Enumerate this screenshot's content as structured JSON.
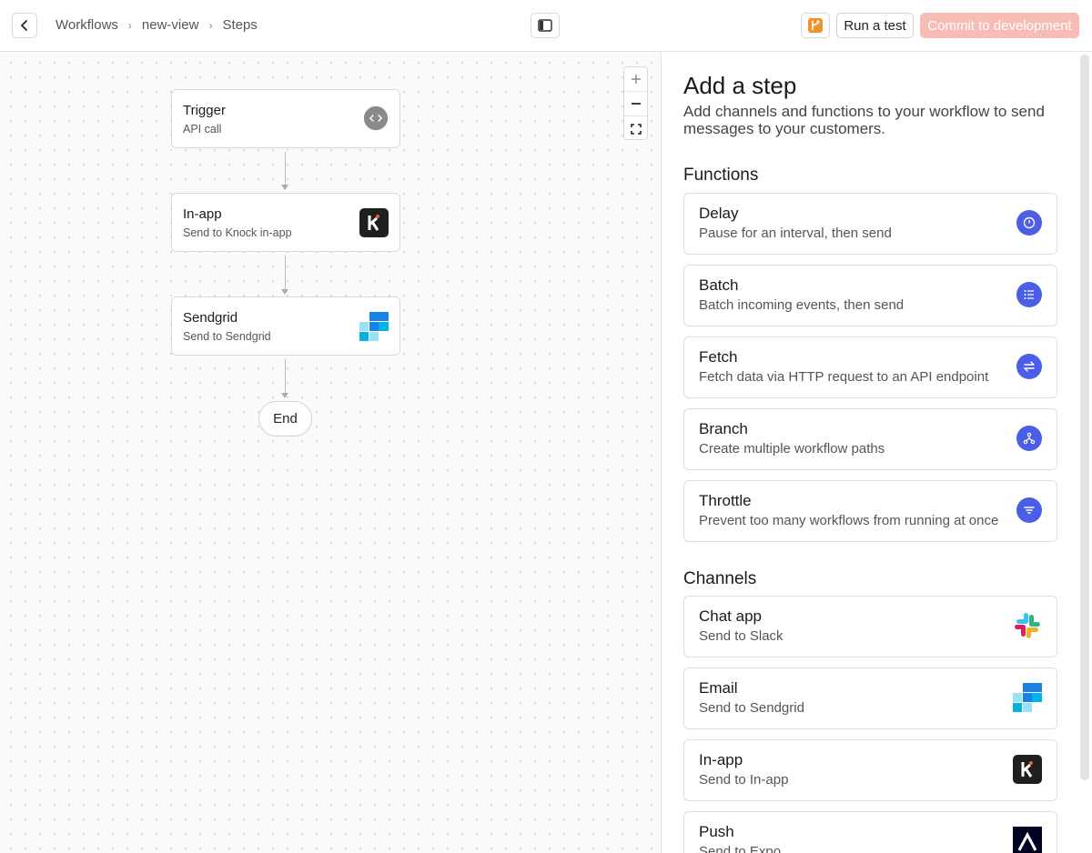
{
  "topbar": {
    "breadcrumbs": [
      "Workflows",
      "new-view",
      "Steps"
    ],
    "run_test_label": "Run a test",
    "commit_label": "Commit to development"
  },
  "canvas": {
    "nodes": [
      {
        "title": "Trigger",
        "subtitle": "API call",
        "icon": "code-icon"
      },
      {
        "title": "In-app",
        "subtitle": "Send to Knock in-app",
        "icon": "knock-logo"
      },
      {
        "title": "Sendgrid",
        "subtitle": "Send to Sendgrid",
        "icon": "sendgrid-logo"
      }
    ],
    "end_label": "End"
  },
  "panel": {
    "title": "Add a step",
    "description": "Add channels and functions to your workflow to send messages to your customers.",
    "functions_heading": "Functions",
    "functions": [
      {
        "title": "Delay",
        "description": "Pause for an interval, then send",
        "icon": "clock-icon"
      },
      {
        "title": "Batch",
        "description": "Batch incoming events, then send",
        "icon": "list-icon"
      },
      {
        "title": "Fetch",
        "description": "Fetch data via HTTP request to an API endpoint",
        "icon": "swap-arrows-icon"
      },
      {
        "title": "Branch",
        "description": "Create multiple workflow paths",
        "icon": "branch-icon"
      },
      {
        "title": "Throttle",
        "description": "Prevent too many workflows from running at once",
        "icon": "filter-icon"
      }
    ],
    "channels_heading": "Channels",
    "channels": [
      {
        "title": "Chat app",
        "description": "Send to Slack",
        "icon": "slack-logo"
      },
      {
        "title": "Email",
        "description": "Send to Sendgrid",
        "icon": "sendgrid-logo"
      },
      {
        "title": "In-app",
        "description": "Send to In-app",
        "icon": "knock-logo"
      },
      {
        "title": "Push",
        "description": "Send to Expo",
        "icon": "expo-logo"
      }
    ]
  },
  "colors": {
    "accent": "#4a5ee8",
    "commit_disabled": "#f8bcb6",
    "branch_icon": "#f0932b"
  }
}
